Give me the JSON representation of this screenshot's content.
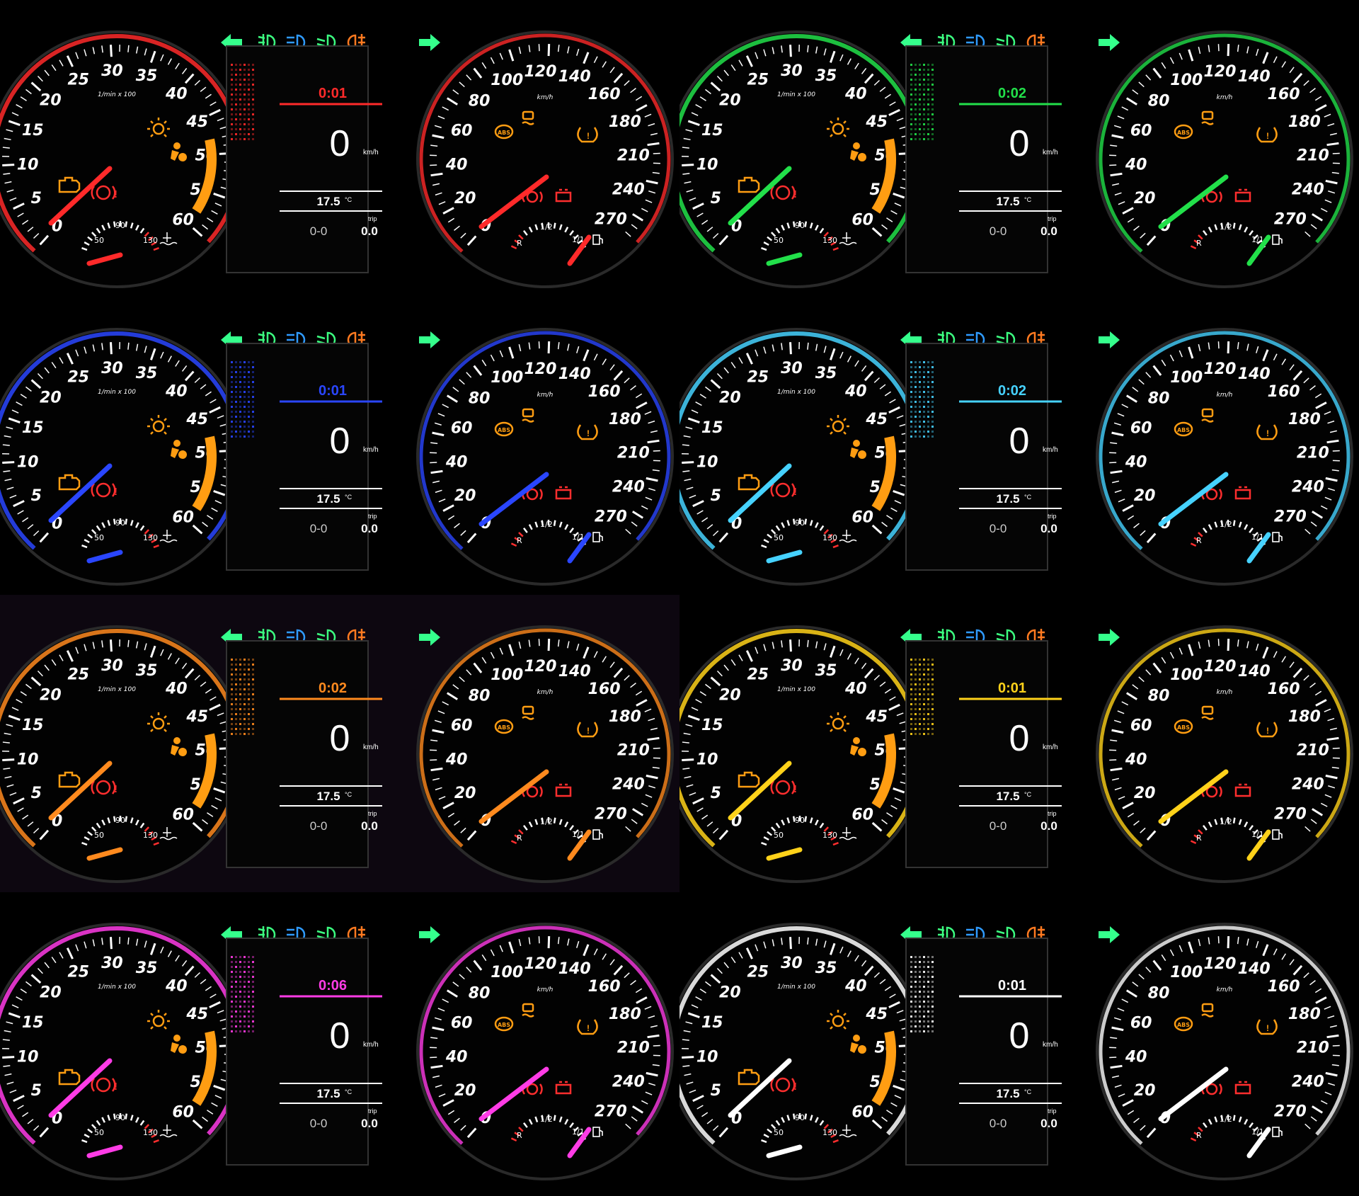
{
  "gauge_text": {
    "tach_numbers": [
      "0",
      "5",
      "10",
      "15",
      "20",
      "25",
      "30",
      "35",
      "40",
      "45",
      "50",
      "55",
      "60"
    ],
    "tach_unit": "1/min x 100",
    "speed_numbers": [
      "0",
      "20",
      "40",
      "60",
      "80",
      "100",
      "120",
      "140",
      "160",
      "180",
      "210",
      "240",
      "270"
    ],
    "speed_unit": "km/h",
    "temp_low": "50",
    "temp_mid": "90",
    "temp_high": "130",
    "fuel_half": "1/2",
    "fuel_full": "1/1",
    "reverse": "R",
    "lcd_speed": "0",
    "lcd_speed_unit": "km/h",
    "lcd_temp": "17.5",
    "lcd_temp_unit": "°C",
    "lcd_odo": "0-0",
    "lcd_trip_label": "trip",
    "lcd_trip": "0.0"
  },
  "panels": [
    {
      "time": "0:01",
      "color": "#ff2a2a",
      "bg": "#000000"
    },
    {
      "time": "0:02",
      "color": "#22e04a",
      "bg": "#000000"
    },
    {
      "time": "0:01",
      "color": "#2a46ff",
      "bg": "#000000"
    },
    {
      "time": "0:02",
      "color": "#46d2ff",
      "bg": "#000000"
    },
    {
      "time": "0:02",
      "color": "#ff8a1e",
      "bg": "#0d0710"
    },
    {
      "time": "0:01",
      "color": "#ffd21a",
      "bg": "#000000"
    },
    {
      "time": "0:06",
      "color": "#ff3ce6",
      "bg": "#000000"
    },
    {
      "time": "0:01",
      "color": "#ffffff",
      "bg": "#000000"
    }
  ],
  "warning_colors": {
    "amber": "#ff9d12",
    "red": "#ff2e2e",
    "green_arrow": "#35ff8c",
    "green_lamp": "#3cff80",
    "blue_lamp": "#2f9bff",
    "orange_lamp": "#ff7a20"
  },
  "icons": [
    "turn-left-icon",
    "front-fog-icon",
    "high-beam-icon",
    "low-beam-icon",
    "rear-fog-icon",
    "turn-right-icon",
    "check-engine-icon",
    "airbag-icon",
    "glow-plug-icon",
    "brake-warning-icon",
    "abs-icon",
    "traction-control-icon",
    "tire-pressure-icon",
    "battery-icon",
    "fuel-pump-icon",
    "coolant-icon"
  ]
}
